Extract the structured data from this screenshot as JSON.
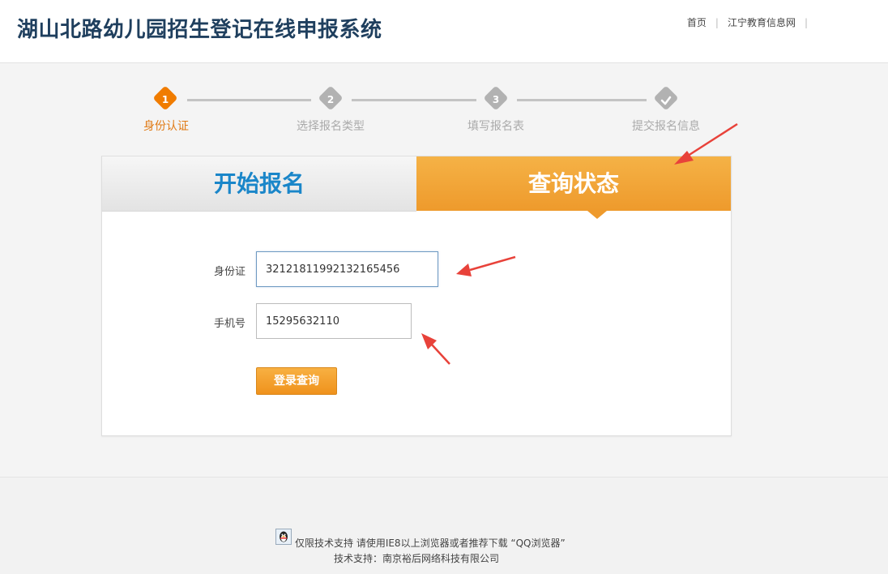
{
  "header": {
    "title": "湖山北路幼儿园招生登记在线申报系统",
    "links": [
      "首页",
      "江宁教育信息网"
    ],
    "trailing_separator": "|"
  },
  "stepper": {
    "steps": [
      {
        "number": "1",
        "label": "身份认证",
        "state": "active"
      },
      {
        "number": "2",
        "label": "选择报名类型",
        "state": "inactive"
      },
      {
        "number": "3",
        "label": "填写报名表",
        "state": "inactive"
      },
      {
        "icon": "checkmark-icon",
        "label": "提交报名信息",
        "state": "inactive"
      }
    ]
  },
  "tabs": {
    "start": "开始报名",
    "query": "查询状态",
    "selected": "query"
  },
  "form": {
    "id_label": "身份证",
    "id_value": "32121811992132165456",
    "phone_label": "手机号",
    "phone_value": "15295632110",
    "submit_label": "登录查询"
  },
  "footer": {
    "line1": "仅限技术支持 请使用IE8以上浏览器或者推荐下载 “QQ浏览器”",
    "line2": "技术支持：南京裕后网络科技有限公司",
    "icon": "qq-penguin-icon"
  },
  "colors": {
    "brand_blue": "#1f3f5e",
    "active_orange": "#f07c00",
    "tab_orange": "#ee9a2c",
    "tab_blue_text": "#1a86c9",
    "annotation_red": "#e8423a"
  }
}
